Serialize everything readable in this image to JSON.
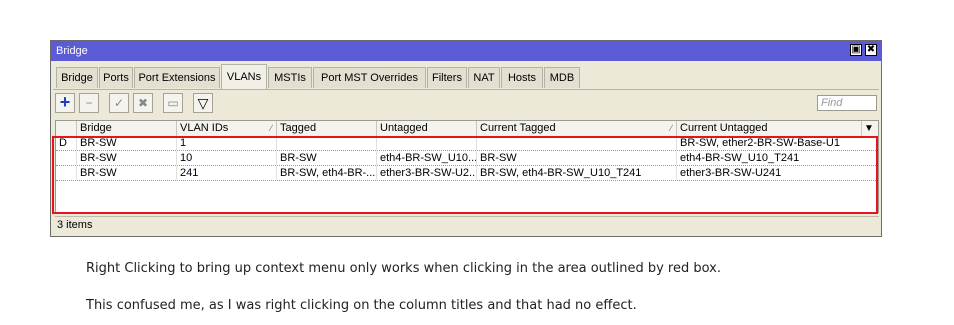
{
  "window": {
    "title": "Bridge",
    "buttons": {
      "restore": "▣",
      "close": "✖"
    }
  },
  "tabs": [
    {
      "label": "Bridge"
    },
    {
      "label": "Ports"
    },
    {
      "label": "Port Extensions"
    },
    {
      "label": "VLANs",
      "active": true
    },
    {
      "label": "MSTIs"
    },
    {
      "label": "Port MST Overrides"
    },
    {
      "label": "Filters"
    },
    {
      "label": "NAT"
    },
    {
      "label": "Hosts"
    },
    {
      "label": "MDB"
    }
  ],
  "toolbar": {
    "add": "+",
    "remove": "−",
    "enable": "✓",
    "disable": "✖",
    "comment": "▭",
    "filter": "▽",
    "find_placeholder": "Find"
  },
  "table": {
    "columns": [
      "",
      "Bridge",
      "VLAN IDs",
      "Tagged",
      "Untagged",
      "Current Tagged",
      "Current Untagged"
    ],
    "dropdown": "▼",
    "sort_mark": "∕",
    "rows": [
      {
        "flag": "D",
        "bridge": "BR-SW",
        "vlan_ids": "1",
        "tagged": "",
        "untagged": "",
        "current_tagged": "",
        "current_untagged": "BR-SW, ether2-BR-SW-Base-U1"
      },
      {
        "flag": "",
        "bridge": "BR-SW",
        "vlan_ids": "10",
        "tagged": "BR-SW",
        "untagged": "eth4-BR-SW_U10...",
        "current_tagged": "BR-SW",
        "current_untagged": "eth4-BR-SW_U10_T241"
      },
      {
        "flag": "",
        "bridge": "BR-SW",
        "vlan_ids": "241",
        "tagged": "BR-SW, eth4-BR-...",
        "untagged": "ether3-BR-SW-U2...",
        "current_tagged": "BR-SW, eth4-BR-SW_U10_T241",
        "current_untagged": "ether3-BR-SW-U241"
      }
    ]
  },
  "status": "3 items",
  "notes": [
    "Right Clicking to bring up context menu only works when clicking in the area outlined by red box.",
    "This confused me,  as I was right clicking on the column titles and that had no effect."
  ],
  "colors": {
    "titlebar": "#5b5bd6",
    "outline": "#e8141b"
  }
}
